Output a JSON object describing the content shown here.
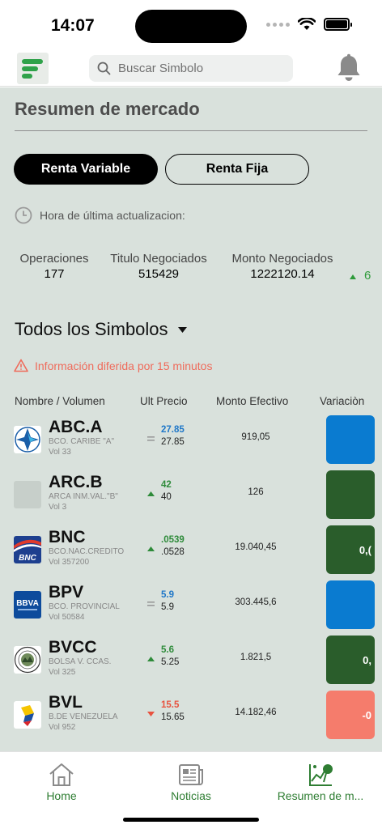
{
  "status": {
    "time": "14:07"
  },
  "header": {
    "search_placeholder": "Buscar Simbolo"
  },
  "main": {
    "title": "Resumen de mercado",
    "tabs": [
      {
        "label": "Renta Variable",
        "active": true
      },
      {
        "label": "Renta Fija",
        "active": false
      }
    ],
    "update_label": "Hora de última actualizacion:",
    "stats": [
      {
        "label": "Operaciones",
        "value": "177"
      },
      {
        "label": "Titulo Negociados",
        "value": "515429"
      },
      {
        "label": "Monto Negociados",
        "value": "1222120.14"
      }
    ],
    "stat_cut": "6",
    "symbols_title": "Todos los Simbolos",
    "delay_notice": "Información diferida por 15 minutos",
    "columns": [
      "Nombre / Volumen",
      "Ult Precio",
      "Monto Efectivo",
      "Variaciòn"
    ],
    "rows": [
      {
        "code": "ABC.A",
        "name": "BCO. CARIBE \"A\"",
        "vol": "Vol 33",
        "price": "27.85",
        "prev": "27.85",
        "trend": "equal",
        "monto": "919,05",
        "variation": "",
        "pill_color": "#0a7bd0"
      },
      {
        "code": "ARC.B",
        "name": "ARCA INM.VAL.\"B\"",
        "vol": "Vol 3",
        "price": "42",
        "prev": "40",
        "trend": "up",
        "monto": "126",
        "variation": "",
        "pill_color": "#2a5d2b"
      },
      {
        "code": "BNC",
        "name": "BCO.NAC.CREDITO",
        "vol": "Vol 357200",
        "price": ".0539",
        "prev": ".0528",
        "trend": "up",
        "monto": "19.040,45",
        "variation": "0,(",
        "pill_color": "#2a5d2b"
      },
      {
        "code": "BPV",
        "name": "BCO. PROVINCIAL",
        "vol": "Vol 50584",
        "price": "5.9",
        "prev": "5.9",
        "trend": "equal",
        "monto": "303.445,6",
        "variation": "",
        "pill_color": "#0a7bd0"
      },
      {
        "code": "BVCC",
        "name": "BOLSA V. CCAS.",
        "vol": "Vol 325",
        "price": "5.6",
        "prev": "5.25",
        "trend": "up",
        "monto": "1.821,5",
        "variation": "0,",
        "pill_color": "#2a5d2b"
      },
      {
        "code": "BVL",
        "name": "B.DE VENEZUELA",
        "vol": "Vol 952",
        "price": "15.5",
        "prev": "15.65",
        "trend": "down",
        "monto": "14.182,46",
        "variation": "-0",
        "pill_color": "#f57c6c"
      }
    ]
  },
  "colors": {
    "up": "#2e8b3a",
    "down": "#e8523f",
    "equal": "#1f77c8",
    "brand": "#2fa24a"
  },
  "nav": [
    {
      "label": "Home",
      "icon": "home-icon"
    },
    {
      "label": "Noticias",
      "icon": "newspaper-icon"
    },
    {
      "label": "Resumen de m...",
      "icon": "market-summary-icon"
    }
  ]
}
